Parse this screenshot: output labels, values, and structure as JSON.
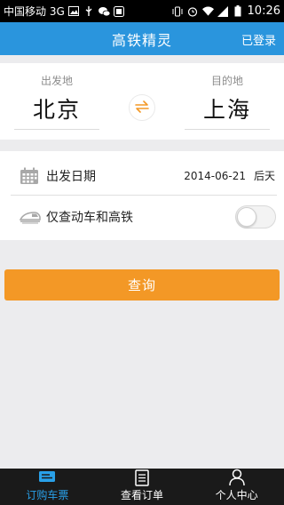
{
  "status_bar": {
    "carrier": "中国移动 3G",
    "time": "10:26"
  },
  "header": {
    "title": "高铁精灵",
    "login_label": "已登录"
  },
  "stations": {
    "from_label": "出发地",
    "from_name": "北京",
    "to_label": "目的地",
    "to_name": "上海",
    "swap_icon": "swap-arrows-icon"
  },
  "options": {
    "date_label": "出发日期",
    "date_value": "2014-06-21",
    "date_day": "后天",
    "date_icon": "calendar-icon",
    "filter_label": "仅查动车和高铁",
    "filter_icon": "train-icon",
    "filter_enabled": false
  },
  "search_button": {
    "label": "查询"
  },
  "tabs": [
    {
      "label": "订购车票",
      "icon": "ticket-icon",
      "active": true
    },
    {
      "label": "查看订单",
      "icon": "order-list-icon",
      "active": false
    },
    {
      "label": "个人中心",
      "icon": "person-icon",
      "active": false
    }
  ],
  "colors": {
    "header_bg": "#2a95dd",
    "accent_orange": "#f39826",
    "active_tab": "#29a0e8",
    "tab_bar_bg": "#1a1a1a"
  }
}
